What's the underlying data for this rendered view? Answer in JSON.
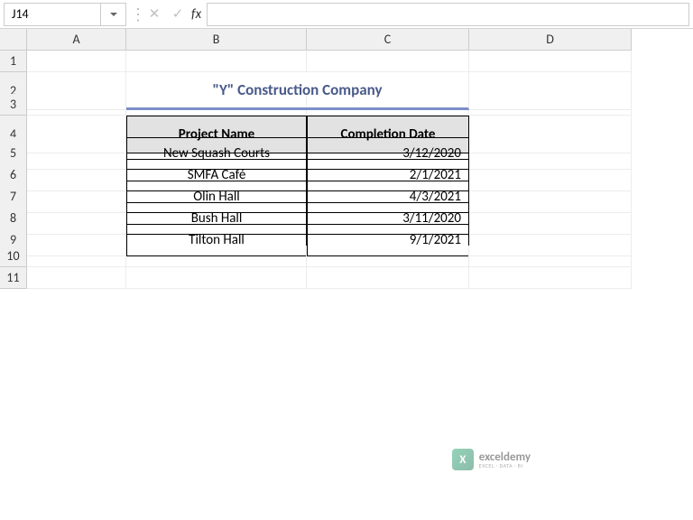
{
  "namebox": {
    "value": "J14"
  },
  "formula_bar": {
    "value": ""
  },
  "columns": [
    "A",
    "B",
    "C",
    "D"
  ],
  "row_labels": [
    "1",
    "2",
    "3",
    "4",
    "5",
    "6",
    "7",
    "8",
    "9",
    "10",
    "11"
  ],
  "title": "\"Y\" Construction Company",
  "headers": {
    "project": "Project Name",
    "date": "Completion Date"
  },
  "rows": [
    {
      "project": "New Squash Courts",
      "date": "3/12/2020"
    },
    {
      "project": "SMFA Café",
      "date": "2/1/2021"
    },
    {
      "project": "Olin Hall",
      "date": "4/3/2021"
    },
    {
      "project": "Bush Hall",
      "date": "3/11/2020"
    },
    {
      "project": "Tilton Hall",
      "date": "9/1/2021"
    }
  ],
  "watermark": {
    "main": "exceldemy",
    "sub": "EXCEL · DATA · BI",
    "icon": "X"
  },
  "fx": {
    "label": "fx",
    "cancel": "✕",
    "enter": "✓"
  }
}
